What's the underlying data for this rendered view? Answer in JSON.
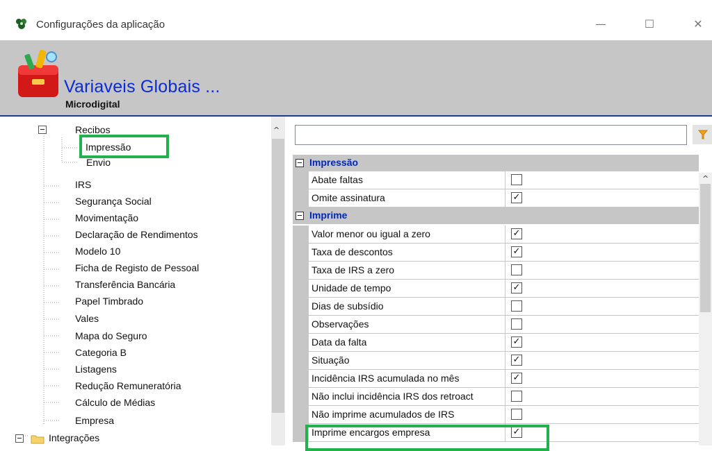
{
  "window": {
    "title": "Configurações da aplicação",
    "minimize": "—",
    "maximize": "☐",
    "close": "✕"
  },
  "header": {
    "title": "Variaveis Globais ...",
    "subtitle": "Microdigital"
  },
  "tree": {
    "items": [
      {
        "label": "Recibos"
      },
      {
        "label": "Impressão"
      },
      {
        "label": "Envio"
      },
      {
        "label": "IRS"
      },
      {
        "label": "Segurança Social"
      },
      {
        "label": "Movimentação"
      },
      {
        "label": "Declaração de Rendimentos"
      },
      {
        "label": "Modelo 10"
      },
      {
        "label": "Ficha de Registo de Pessoal"
      },
      {
        "label": "Transferência Bancária"
      },
      {
        "label": "Papel Timbrado"
      },
      {
        "label": "Vales"
      },
      {
        "label": "Mapa do Seguro"
      },
      {
        "label": "Categoria B"
      },
      {
        "label": "Listagens"
      },
      {
        "label": "Redução Remuneratória"
      },
      {
        "label": "Cálculo de Médias"
      },
      {
        "label": "Empresa"
      },
      {
        "label": "Integrações"
      }
    ]
  },
  "search": {
    "value": ""
  },
  "grid": {
    "categories": [
      {
        "label": "Impressão"
      },
      {
        "label": "Imprime"
      }
    ],
    "rows": [
      {
        "label": "Abate faltas",
        "checked": false
      },
      {
        "label": "Omite assinatura",
        "checked": true
      },
      {
        "label": "Valor menor ou igual a zero",
        "checked": true
      },
      {
        "label": "Taxa de descontos",
        "checked": true
      },
      {
        "label": "Taxa de IRS a zero",
        "checked": false
      },
      {
        "label": "Unidade de tempo",
        "checked": true
      },
      {
        "label": "Dias de subsídio",
        "checked": false
      },
      {
        "label": "Observações",
        "checked": false
      },
      {
        "label": "Data da falta",
        "checked": true
      },
      {
        "label": "Situação",
        "checked": true
      },
      {
        "label": "Incidência IRS acumulada no mês",
        "checked": true
      },
      {
        "label": "Não inclui incidência IRS dos retroact",
        "checked": false
      },
      {
        "label": "Não imprime acumulados de IRS",
        "checked": false
      },
      {
        "label": "Imprime encargos empresa",
        "checked": true
      }
    ]
  },
  "colors": {
    "header_title": "#0a2bd6",
    "category_text": "#0028b8",
    "highlight": "#22b14c",
    "header_border": "#1a3d8c"
  }
}
